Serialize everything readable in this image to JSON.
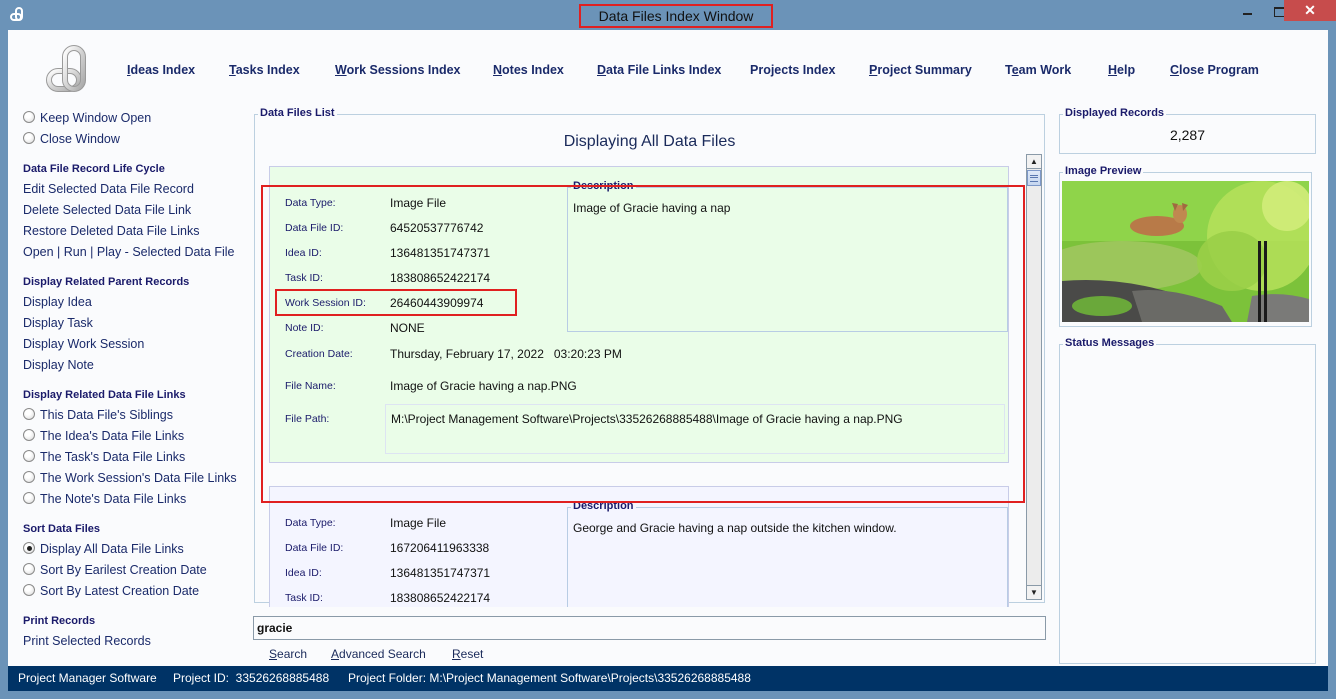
{
  "window": {
    "title": "Data Files Index Window",
    "close_glyph": "✕"
  },
  "nav": [
    {
      "label": "Ideas Index",
      "mnemonic": "I",
      "rest": "deas Index"
    },
    {
      "label": "Tasks Index",
      "mnemonic": "T",
      "rest": "asks Index"
    },
    {
      "label": "Work Sessions Index",
      "mnemonic": "W",
      "rest": "ork Sessions Index"
    },
    {
      "label": "Notes Index",
      "mnemonic": "N",
      "rest": "otes Index"
    },
    {
      "label": "Data File Links Index",
      "mnemonic": "D",
      "rest": "ata File Links Index"
    },
    {
      "label": "Projects Index",
      "mnemonic": "",
      "rest": "Projects Index"
    },
    {
      "label": "Project Summary",
      "mnemonic": "P",
      "rest": "roject Summary"
    },
    {
      "label": "Team Work",
      "pre": "T",
      "mnemonic": "e",
      "rest": "am Work"
    },
    {
      "label": "Help",
      "mnemonic": "H",
      "rest": "elp"
    },
    {
      "label": "Close Program",
      "mnemonic": "C",
      "rest": "lose Program"
    }
  ],
  "sidebar": {
    "window_options": [
      {
        "label": "Keep Window Open",
        "checked": false
      },
      {
        "label": "Close Window",
        "checked": false
      }
    ],
    "life_cycle": {
      "heading": "Data File Record Life Cycle",
      "items": [
        "Edit Selected Data File Record",
        "Delete Selected Data File Link",
        "Restore Deleted Data File Links",
        "Open | Run | Play - Selected Data File"
      ]
    },
    "parent_records": {
      "heading": "Display Related Parent Records",
      "items": [
        "Display Idea",
        "Display Task",
        "Display Work Session",
        "Display Note"
      ]
    },
    "related_links": {
      "heading": "Display Related Data File Links",
      "items": [
        "This Data File's Siblings",
        "The Idea's Data File Links",
        "The Task's Data File Links",
        "The Work Session's Data File Links",
        "The Note's Data File Links"
      ]
    },
    "sort": {
      "heading": "Sort Data Files",
      "items": [
        {
          "label": "Display All Data File Links",
          "checked": true
        },
        {
          "label": "Sort By Earilest Creation Date",
          "checked": false
        },
        {
          "label": "Sort By Latest Creation Date",
          "checked": false
        }
      ]
    },
    "print": {
      "heading": "Print Records",
      "items": [
        "Print Selected Records"
      ]
    }
  },
  "main": {
    "group_label": "Data Files List",
    "title": "Displaying All Data Files",
    "labels": {
      "data_type": "Data Type:",
      "data_file_id": "Data File ID:",
      "idea_id": "Idea ID:",
      "task_id": "Task ID:",
      "work_session_id": "Work Session ID:",
      "note_id": "Note ID:",
      "creation_date": "Creation Date:",
      "file_name": "File Name:",
      "file_path": "File Path:",
      "description": "Description"
    },
    "records": [
      {
        "data_type": "Image File",
        "data_file_id": "64520537776742",
        "idea_id": "136481351747371",
        "task_id": "183808652422174",
        "work_session_id": "26460443909974",
        "note_id": "NONE",
        "creation_date": "Thursday, February 17, 2022   03:20:23 PM",
        "file_name": "Image of Gracie having a nap.PNG",
        "file_path": "M:\\Project Management Software\\Projects\\33526268885488\\Image of Gracie having a nap.PNG",
        "description": "Image of Gracie having a nap",
        "selected": true
      },
      {
        "data_type": "Image File",
        "data_file_id": "167206411963338",
        "idea_id": "136481351747371",
        "task_id": "183808652422174",
        "description": "George and Gracie having a nap outside the kitchen window.",
        "selected": false
      }
    ],
    "search": {
      "value": "gracie",
      "search_label": "Search",
      "advanced_label": "Advanced Search",
      "reset_label": "Reset"
    }
  },
  "right": {
    "displayed_records_label": "Displayed Records",
    "displayed_records": "2,287",
    "image_preview_label": "Image Preview",
    "status_messages_label": "Status Messages"
  },
  "statusbar": {
    "app_name": "Project Manager Software",
    "project_id": "Project ID:  33526268885488",
    "project_folder": "Project Folder: M:\\Project Management Software\\Projects\\33526268885488"
  },
  "colors": {
    "frame": "#6b93b8",
    "statusbar": "#003366",
    "close_button": "#c74c4c",
    "highlight": "#e02020",
    "selected_record_bg": "#eafde8",
    "record_bg": "#f4f5ff",
    "text_navy": "#1a1a6a"
  }
}
